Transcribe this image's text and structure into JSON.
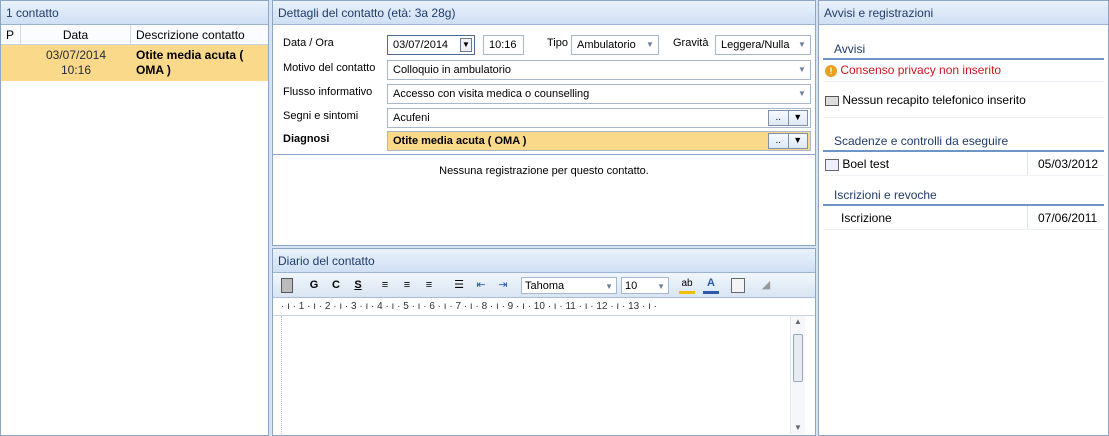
{
  "left": {
    "title": "1 contatto",
    "columns": [
      "P",
      "Data",
      "Descrizione contatto"
    ],
    "rows": [
      {
        "date": "03/07/2014",
        "time": "10:16",
        "desc_line1": "Otite media acuta (",
        "desc_line2": "OMA )"
      }
    ]
  },
  "details": {
    "title": "Dettagli del contatto (età: 3a 28g)",
    "date_label": "Data / Ora",
    "date_value": "03/07/2014",
    "time_value": "10:16",
    "type_label": "Tipo",
    "type_value": "Ambulatorio",
    "severity_label": "Gravità",
    "severity_value": "Leggera/Nulla",
    "reason_label": "Motivo del contatto",
    "reason_value": "Colloquio in ambulatorio",
    "flow_label": "Flusso informativo",
    "flow_value": "Accesso con visita medica o counselling",
    "symptoms_label": "Segni e sintomi",
    "symptoms_value": "Acufeni",
    "diagnosis_label": "Diagnosi",
    "diagnosis_value": "Otite media acuta ( OMA )",
    "browse_button": "..",
    "empty_message": "Nessuna registrazione per questo contatto."
  },
  "diary": {
    "title": "Diario del contatto",
    "bold": "G",
    "italic": "C",
    "underline": "S",
    "font": "Tahoma",
    "size": "10",
    "ruler": "· ı · 1 · ı · 2 · ı · 3 · ı · 4 · ı · 5 · ı · 6 · ı · 7 · ı · 8 · ı · 9 · ı · 10 · ı · 11 · ı · 12 · ı · 13 · ı ·"
  },
  "right": {
    "title": "Avvisi e registrazioni",
    "alerts_header": "Avvisi",
    "alert_privacy": "Consenso privacy non inserito",
    "alert_phone": "Nessun recapito telefonico inserito",
    "deadlines_header": "Scadenze e controlli da eseguire",
    "deadline_name": "Boel test",
    "deadline_date": "05/03/2012",
    "enroll_header": "Iscrizioni e revoche",
    "enroll_name": "Iscrizione",
    "enroll_date": "07/06/2011"
  },
  "colors": {
    "selected_row": "#fbd98a",
    "alert_red": "#d0141e",
    "header_blue": "#1f3c6b"
  }
}
